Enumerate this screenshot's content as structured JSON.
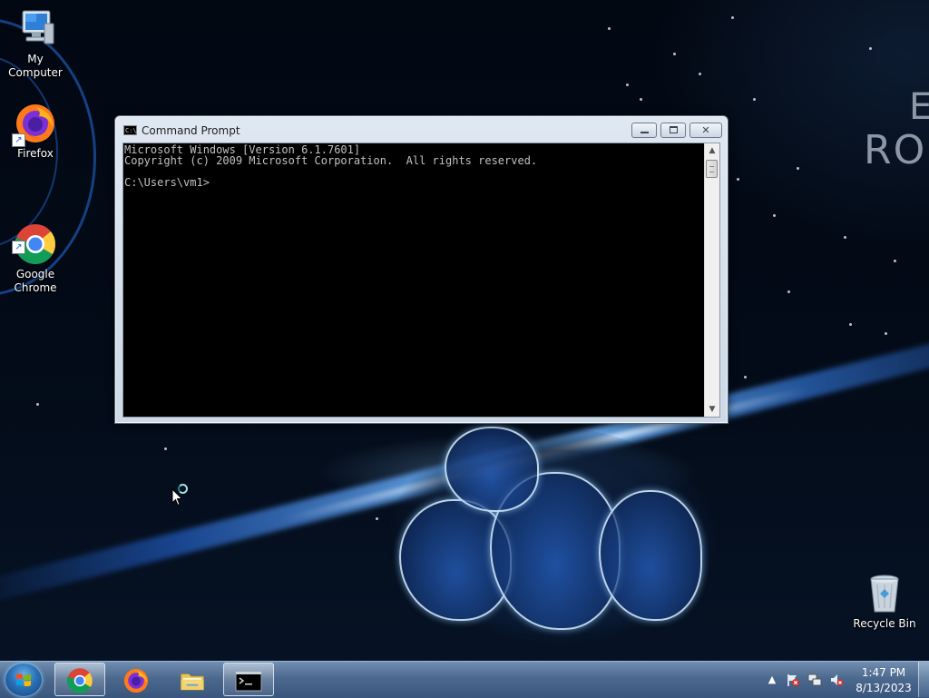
{
  "desktop": {
    "wallpaper_text": [
      "E",
      "RON"
    ],
    "icons": [
      {
        "label": "My Computer",
        "icon": "my-computer-icon"
      },
      {
        "label": "Firefox",
        "icon": "firefox-icon"
      },
      {
        "label": "Google\nChrome",
        "icon": "chrome-icon"
      },
      {
        "label": "Recycle Bin",
        "icon": "recycle-bin-icon"
      }
    ]
  },
  "window": {
    "title": "Command Prompt",
    "icon": "cmd-icon",
    "controls": [
      "minimize",
      "maximize",
      "close"
    ],
    "console_lines": [
      "Microsoft Windows [Version 6.1.7601]",
      "Copyright (c) 2009 Microsoft Corporation.  All rights reserved.",
      "",
      "C:\\Users\\vm1>"
    ]
  },
  "taskbar": {
    "start_icon": "windows-start-icon",
    "items": [
      {
        "name": "Google Chrome",
        "icon": "chrome-icon",
        "state": "pinned"
      },
      {
        "name": "Firefox",
        "icon": "firefox-icon",
        "state": "pinned"
      },
      {
        "name": "Windows Explorer",
        "icon": "folder-icon",
        "state": "pinned"
      },
      {
        "name": "Command Prompt",
        "icon": "cmd-icon",
        "state": "active"
      }
    ],
    "tray": {
      "icons": [
        "show-hidden-icons-chevron",
        "action-center-flag-icon",
        "network-icon",
        "volume-muted-icon"
      ],
      "time": "1:47 PM",
      "date": "8/13/2023"
    }
  },
  "colors": {
    "console_bg": "#000000",
    "console_fg": "#c0c0c0",
    "taskbar": "#5b7fa8"
  }
}
